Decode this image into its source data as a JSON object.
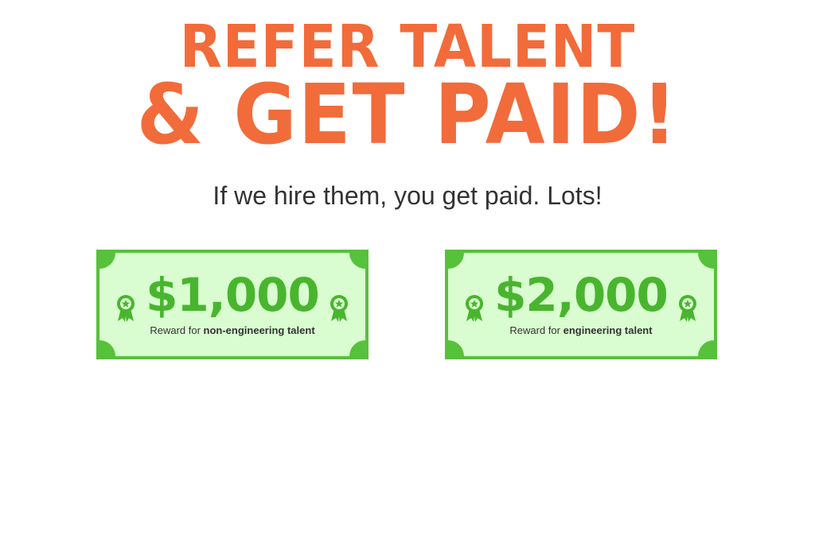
{
  "headline": {
    "line1": "REFER TALENT",
    "line2": "& GET PAID!"
  },
  "subtitle": "If we hire them, you get paid. Lots!",
  "rewards": [
    {
      "amount": "$1,000",
      "caption_prefix": "Reward for ",
      "caption_bold": "non-engineering talent"
    },
    {
      "amount": "$2,000",
      "caption_prefix": "Reward for ",
      "caption_bold": "engineering talent"
    }
  ],
  "colors": {
    "headline": "#f26b3a",
    "bill_fill": "#d9fdd0",
    "bill_border": "#56c13a",
    "amount": "#49b52e"
  },
  "people": [
    {
      "name": "person-green-jacket",
      "hair": "#111111",
      "top": "#2f4a2f",
      "bottom": "#222222",
      "shoes": "#3aa33a"
    },
    {
      "name": "person-black-skirt",
      "hair": "#111111",
      "top": "#f4f4f4",
      "bottom": "#111111",
      "shoes": "#e8c9a8"
    },
    {
      "name": "person-plaid-beard",
      "hair": "#555555",
      "top": "#b22222",
      "bottom": "#2d3e5e",
      "shoes": "#5a3b22"
    },
    {
      "name": "person-overalls",
      "hair": "#6b3d22",
      "top": "#3b3f8f",
      "bottom": "#3b3f8f",
      "shoes": "#3b3f8f"
    },
    {
      "name": "person-blue-cap",
      "hair": "#3a3a3a",
      "top": "#8fb3d1",
      "bottom": "#5a6e82",
      "shoes": "#222222"
    },
    {
      "name": "person-purple-top",
      "hair": "#3a3a4a",
      "top": "#9b6fb9",
      "bottom": "#111111",
      "shoes": "#111111"
    },
    {
      "name": "person-headband",
      "hair": "#111111",
      "top": "#f6f6f6",
      "bottom": "#111111",
      "shoes": "#111111"
    },
    {
      "name": "person-striped-jersey",
      "hair": "#111111",
      "top": "#2b5aa8",
      "bottom": "#ffffff",
      "shoes": "#2b5aa8"
    },
    {
      "name": "person-blonde-dress",
      "hair": "#e8cf6a",
      "top": "#6f8fc9",
      "bottom": "#6f8fc9",
      "shoes": "#6b4a2a"
    },
    {
      "name": "person-goggles-beanie",
      "hair": "#2e3a6e",
      "top": "#3a3a7a",
      "bottom": "#222222",
      "shoes": "#222222"
    },
    {
      "name": "person-pigtails",
      "hair": "#5a2e1a",
      "top": "#2a4a6a",
      "bottom": "#8a2a2a",
      "shoes": "#222222"
    },
    {
      "name": "person-chef",
      "hair": "#ffffff",
      "top": "#f4f4f4",
      "bottom": "#111111",
      "shoes": "#111111"
    },
    {
      "name": "person-white-hair-red-dress",
      "hair": "#d9d9d9",
      "top": "#9b1e1e",
      "bottom": "#6b1414",
      "shoes": "#4a0f0f"
    }
  ]
}
